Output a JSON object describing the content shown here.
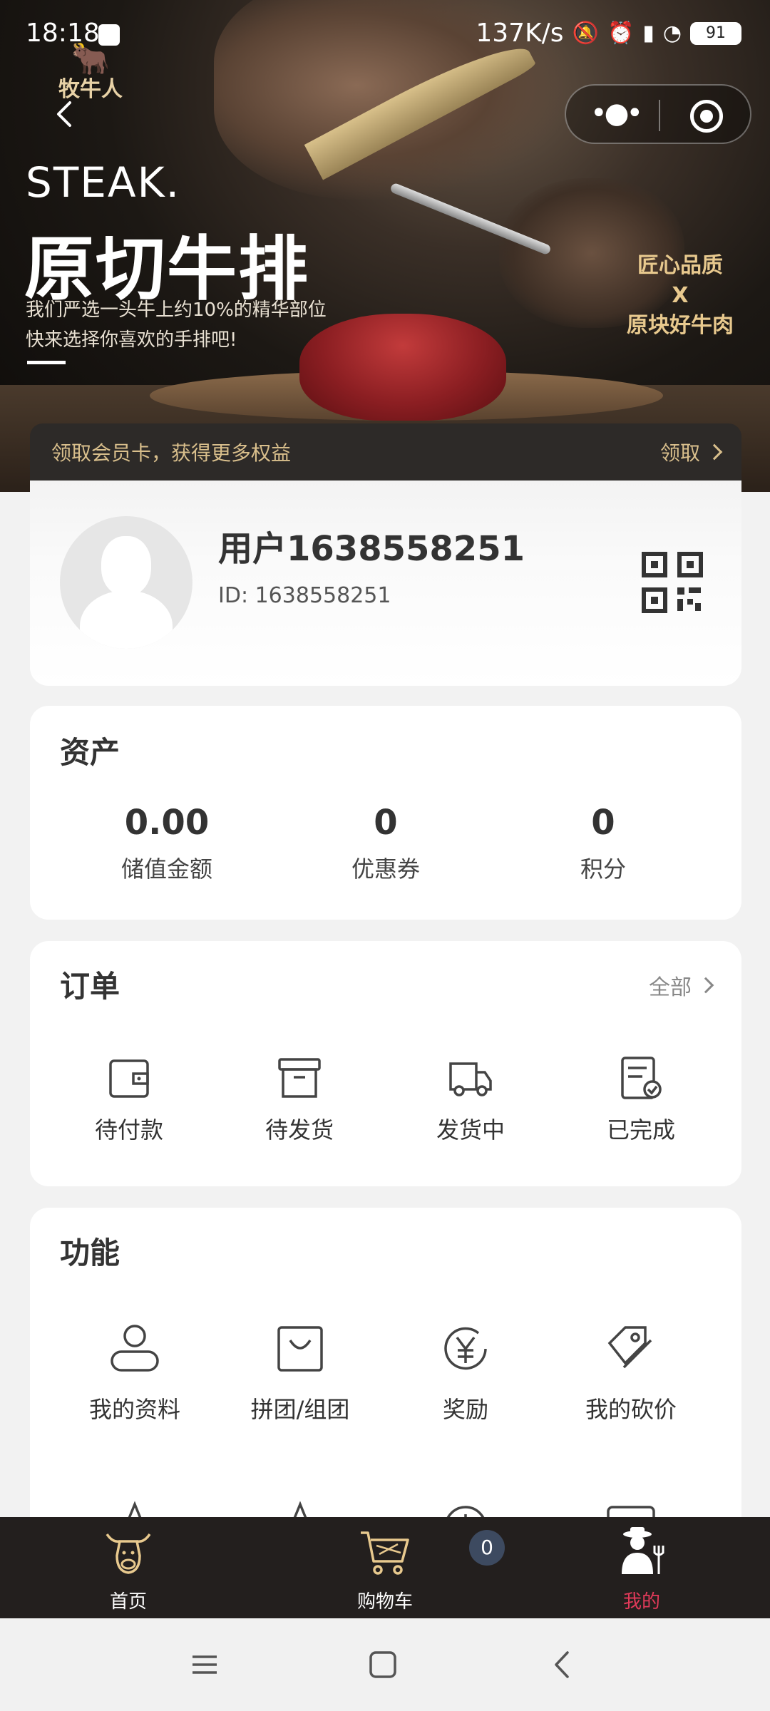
{
  "status_bar": {
    "time": "18:18",
    "network_speed": "137K/s",
    "battery": "91"
  },
  "banner": {
    "logo_text": "牧牛人",
    "en_title": "STEAK.",
    "title": "原切牛排",
    "subtitle_1": "我们严选一头牛上约10%的精华部位",
    "subtitle_2": "快来选择你喜欢的手排吧!",
    "side_line_1": "匠心品质",
    "side_line_2": "X",
    "side_line_3": "原块好牛肉"
  },
  "member": {
    "text": "领取会员卡，获得更多权益",
    "action": "领取"
  },
  "profile": {
    "username": "用户1638558251",
    "user_id": "ID: 1638558251"
  },
  "assets": {
    "title": "资产",
    "items": [
      {
        "value": "0.00",
        "label": "储值金额"
      },
      {
        "value": "0",
        "label": "优惠券"
      },
      {
        "value": "0",
        "label": "积分"
      }
    ]
  },
  "orders": {
    "title": "订单",
    "all_label": "全部",
    "items": [
      {
        "label": "待付款",
        "icon": "wallet-icon"
      },
      {
        "label": "待发货",
        "icon": "box-icon"
      },
      {
        "label": "发货中",
        "icon": "truck-icon"
      },
      {
        "label": "已完成",
        "icon": "checklist-icon"
      }
    ]
  },
  "functions": {
    "title": "功能",
    "items": [
      {
        "label": "我的资料",
        "icon": "user-icon"
      },
      {
        "label": "拼团/组团",
        "icon": "bag-icon"
      },
      {
        "label": "奖励",
        "icon": "yen-icon"
      },
      {
        "label": "我的砍价",
        "icon": "tag-icon"
      }
    ]
  },
  "tabbar": {
    "items": [
      {
        "label": "首页",
        "icon": "cow-icon"
      },
      {
        "label": "购物车",
        "icon": "cart-icon"
      },
      {
        "label": "我的",
        "icon": "farmer-icon"
      }
    ],
    "cart_count": "0",
    "active_color": "#e23a5a"
  }
}
